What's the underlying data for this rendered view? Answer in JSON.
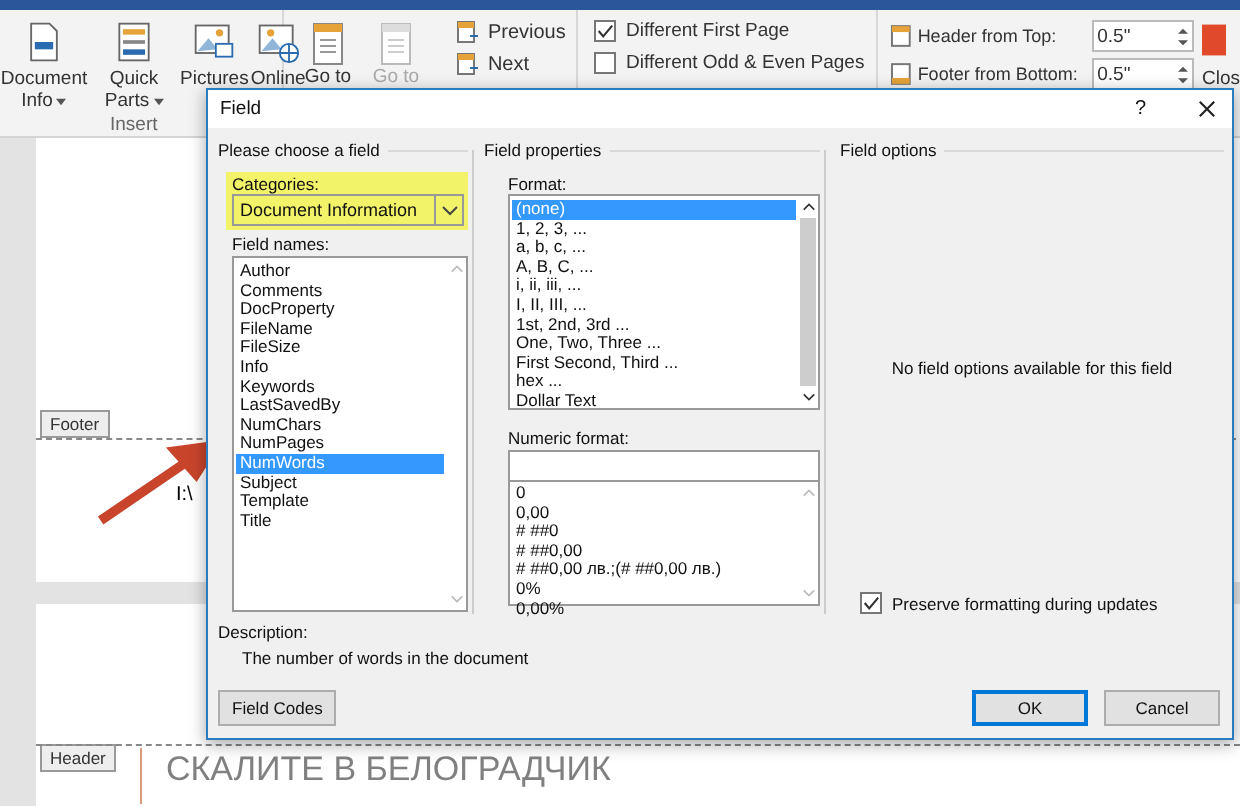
{
  "ribbon": {
    "insert_buttons": [
      {
        "label": "Document Info",
        "dropdown": true
      },
      {
        "label": "Quick Parts",
        "dropdown": true
      },
      {
        "label": "Pictures",
        "dropdown": false
      },
      {
        "label": "Online",
        "dropdown": false
      }
    ],
    "insert_group_label": "Insert",
    "goto_buttons": [
      {
        "label": "Go to",
        "disabled": false
      },
      {
        "label": "Go to",
        "disabled": true
      }
    ],
    "nav_links": [
      "Previous",
      "Next"
    ],
    "options": [
      {
        "label": "Different First Page",
        "checked": true
      },
      {
        "label": "Different Odd & Even Pages",
        "checked": false
      }
    ],
    "position": [
      {
        "label": "Header from Top:",
        "value": "0.5\""
      },
      {
        "label": "Footer from Bottom:",
        "value": "0.5\""
      }
    ],
    "close_label": "Clos"
  },
  "document": {
    "footer_tag": "Footer",
    "footer_text": "I:\\",
    "header_tag": "Header",
    "heading": "СКАЛИТЕ В БЕЛОГРАДЧИК"
  },
  "dialog": {
    "title": "Field",
    "help": "?",
    "choose_section": "Please choose a field",
    "categories_label": "Categories:",
    "category": "Document Information",
    "field_names_label": "Field names:",
    "field_names": [
      {
        "label": "Author",
        "selected": false
      },
      {
        "label": "Comments",
        "selected": false
      },
      {
        "label": "DocProperty",
        "selected": false
      },
      {
        "label": "FileName",
        "selected": false
      },
      {
        "label": "FileSize",
        "selected": false
      },
      {
        "label": "Info",
        "selected": false
      },
      {
        "label": "Keywords",
        "selected": false
      },
      {
        "label": "LastSavedBy",
        "selected": false
      },
      {
        "label": "NumChars",
        "selected": false
      },
      {
        "label": "NumPages",
        "selected": false
      },
      {
        "label": "NumWords",
        "selected": true
      },
      {
        "label": "Subject",
        "selected": false
      },
      {
        "label": "Template",
        "selected": false
      },
      {
        "label": "Title",
        "selected": false
      }
    ],
    "properties_section": "Field properties",
    "format_label": "Format:",
    "formats": [
      {
        "label": "(none)",
        "selected": true
      },
      {
        "label": "1, 2, 3, ...",
        "selected": false
      },
      {
        "label": "a, b, c, ...",
        "selected": false
      },
      {
        "label": "A, B, C, ...",
        "selected": false
      },
      {
        "label": "i, ii, iii, ...",
        "selected": false
      },
      {
        "label": "I, II, III, ...",
        "selected": false
      },
      {
        "label": "1st, 2nd, 3rd ...",
        "selected": false
      },
      {
        "label": "One, Two, Three ...",
        "selected": false
      },
      {
        "label": "First Second, Third ...",
        "selected": false
      },
      {
        "label": "hex ...",
        "selected": false
      },
      {
        "label": "Dollar Text",
        "selected": false
      }
    ],
    "numeric_label": "Numeric format:",
    "numeric_formats": [
      "0",
      "0,00",
      "# ##0",
      "# ##0,00",
      "# ##0,00 лв.;(# ##0,00 лв.)",
      "0%",
      "0,00%"
    ],
    "options_section": "Field options",
    "options_message": "No field options available for this field",
    "preserve": {
      "label": "Preserve formatting during updates",
      "checked": true
    },
    "description_label": "Description:",
    "description": "The number of words in the document",
    "field_codes_button": "Field Codes",
    "buttons": [
      {
        "label": "OK",
        "default": true
      },
      {
        "label": "Cancel",
        "default": false
      }
    ]
  }
}
